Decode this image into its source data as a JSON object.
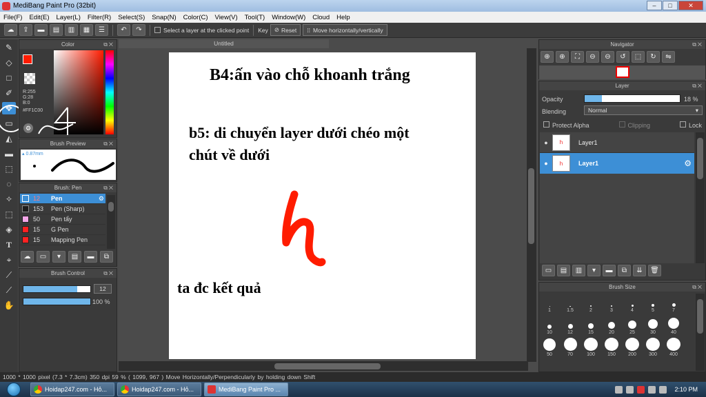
{
  "window": {
    "title": "MediBang Paint Pro (32bit)"
  },
  "menu": [
    "File(F)",
    "Edit(E)",
    "Layer(L)",
    "Filter(R)",
    "Select(S)",
    "Snap(N)",
    "Color(C)",
    "View(V)",
    "Tool(T)",
    "Window(W)",
    "Cloud",
    "Help"
  ],
  "toolbar": {
    "select_layer_label": "Select a layer at the clicked point",
    "key_label": "Key",
    "reset_label": "Reset",
    "move_mode_label": "Move horizontally/vertically"
  },
  "color_panel": {
    "title": "Color",
    "r": "R:255",
    "g": "G:28",
    "b": "B:0",
    "hex": "#FF1C00",
    "main_color": "#ff1c00"
  },
  "brush_preview": {
    "title": "Brush Preview",
    "size": "0.87mm"
  },
  "brush_list": {
    "title": "Brush: Pen",
    "items": [
      {
        "size": "12",
        "name": "Pen",
        "color": "#3d8fd6"
      },
      {
        "size": "153",
        "name": "Pen (Sharp)",
        "color": "#1e1e1e"
      },
      {
        "size": "50",
        "name": "Pen tẩy",
        "color": "#f4a6e8"
      },
      {
        "size": "15",
        "name": "G Pen",
        "color": "#ff2222"
      },
      {
        "size": "15",
        "name": "Mapping Pen",
        "color": "#ff2222"
      }
    ]
  },
  "brush_control": {
    "title": "Brush Control",
    "size_value": "12",
    "opacity_value": "100 %",
    "size_fraction": 0.8,
    "opacity_fraction": 1.0
  },
  "document": {
    "tab": "Untitled"
  },
  "canvas_text": {
    "line1": "B4:ấn vào chỗ khoanh trắng",
    "line2": "b5: di chuyển layer dưới chéo một",
    "line3": "chút về dưới",
    "line4": "ta đc kết quả",
    "handwritten": "h",
    "annotation_number": "4"
  },
  "navigator": {
    "title": "Navigator"
  },
  "layer_panel": {
    "title": "Layer",
    "opacity_label": "Opacity",
    "opacity_value": "18 %",
    "opacity_fraction": 0.18,
    "blending_label": "Blending",
    "blending_value": "Normal",
    "protect_alpha": "Protect Alpha",
    "clipping": "Clipping",
    "lock": "Lock",
    "layers": [
      {
        "name": "Layer1",
        "selected": false
      },
      {
        "name": "Layer1",
        "selected": true
      }
    ]
  },
  "brush_size": {
    "title": "Brush Size",
    "sizes": [
      "1",
      "1.5",
      "2",
      "3",
      "4",
      "5",
      "7",
      "10",
      "12",
      "15",
      "20",
      "25",
      "30",
      "40",
      "50",
      "70",
      "100",
      "150",
      "200",
      "300",
      "400"
    ]
  },
  "status": {
    "text": "1000 * 1000 pixel   (7.3 * 7.3cm)   350 dpi   59 %   ( 1099, 967 )   Move Horizontally/Perpendicularly by holding down Shift"
  },
  "taskbar": {
    "tasks": [
      "Hoidap247.com - Hỏ...",
      "Hoidap247.com - Hỏ...",
      "MediBang Paint Pro ..."
    ],
    "clock": "2:10 PM"
  }
}
